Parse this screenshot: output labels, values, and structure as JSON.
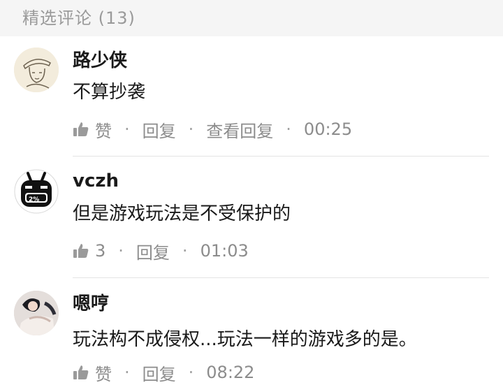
{
  "section": {
    "title": "精选评论 (13)"
  },
  "comments": [
    {
      "author": "路少侠",
      "text": "不算抄袭",
      "like_label": "赞",
      "reply_label": "回复",
      "view_replies_label": "查看回复",
      "time": "00:25"
    },
    {
      "author": "vczh",
      "avatar_badge": "2%",
      "text": "但是游戏玩法是不受保护的",
      "like_label": "3",
      "reply_label": "回复",
      "time": "01:03"
    },
    {
      "author": "嗯哼",
      "text": "玩法构不成侵权...玩法一样的游戏多的是。",
      "like_label": "赞",
      "reply_label": "回复",
      "time": "08:22"
    }
  ],
  "colors": {
    "header_bg": "#f5f5f5",
    "muted": "#8c8c8c"
  },
  "icons": {
    "like": "thumbs-up-icon"
  }
}
